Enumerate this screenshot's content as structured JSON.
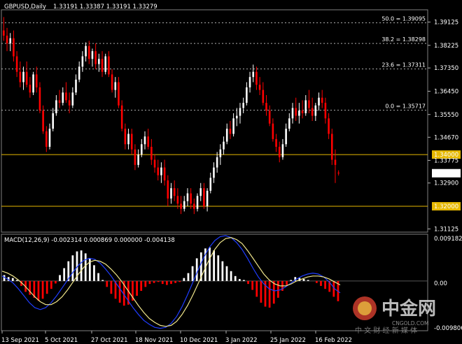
{
  "window": {
    "symbol_label": "GBPUSD,Daily",
    "ohlc_label": "1.33191 1.33387 1.33191 1.33279"
  },
  "macd": {
    "label": "MACD(12,26,9) -0.002314 0.000869 0.000000 -0.004138",
    "right_ticks": [
      "0.009182",
      "0.00",
      "-0.009806"
    ]
  },
  "fib": [
    {
      "label": "50.0 = 1.39095",
      "price": 1.39095
    },
    {
      "label": "38.2 = 1.38298",
      "price": 1.38298
    },
    {
      "label": "23.6 = 1.37311",
      "price": 1.37311
    },
    {
      "label": "0.0 = 1.35717",
      "price": 1.35717
    }
  ],
  "levels": [
    {
      "label": "1.34000",
      "price": 1.34
    },
    {
      "label": "1.32000",
      "price": 1.32
    }
  ],
  "current_price": {
    "label": "1.33279",
    "price": 1.33279
  },
  "y_ticks": [
    "1.39125",
    "1.38225",
    "1.37350",
    "1.36450",
    "1.35550",
    "1.34670",
    "1.33775",
    "1.32900",
    "1.31125"
  ],
  "x_ticks": [
    "13 Sep 2021",
    "5 Oct 2021",
    "27 Oct 2021",
    "18 Nov 2021",
    "10 Dec 2021",
    "3 Jan 2022",
    "25 Jan 2022",
    "16 Feb 2022"
  ],
  "watermark": {
    "text": "中金网",
    "url": "CNGOLD.COM",
    "sub": "中 文 财 经 新 媒 体"
  },
  "colors": {
    "up": "#ffffff",
    "down": "#ff0000",
    "level": "#e6b800",
    "macd_line": "#1f3dff",
    "signal_line": "#f0e68c",
    "grid": "#b0b0b0"
  },
  "chart_data": {
    "type": "candlestick",
    "ylim": [
      1.31,
      1.396
    ],
    "candles": [
      [
        1.388,
        1.3932,
        1.384,
        1.386
      ],
      [
        1.386,
        1.389,
        1.38,
        1.383
      ],
      [
        1.383,
        1.387,
        1.38,
        1.385
      ],
      [
        1.385,
        1.388,
        1.376,
        1.378
      ],
      [
        1.378,
        1.38,
        1.37,
        1.372
      ],
      [
        1.372,
        1.376,
        1.366,
        1.368
      ],
      [
        1.368,
        1.374,
        1.365,
        1.372
      ],
      [
        1.372,
        1.376,
        1.366,
        1.367
      ],
      [
        1.367,
        1.37,
        1.362,
        1.364
      ],
      [
        1.364,
        1.372,
        1.363,
        1.371
      ],
      [
        1.371,
        1.374,
        1.364,
        1.366
      ],
      [
        1.366,
        1.368,
        1.356,
        1.357
      ],
      [
        1.357,
        1.359,
        1.348,
        1.349
      ],
      [
        1.349,
        1.351,
        1.341,
        1.343
      ],
      [
        1.343,
        1.352,
        1.342,
        1.35
      ],
      [
        1.35,
        1.358,
        1.349,
        1.356
      ],
      [
        1.356,
        1.363,
        1.355,
        1.361
      ],
      [
        1.361,
        1.365,
        1.358,
        1.36
      ],
      [
        1.36,
        1.366,
        1.359,
        1.364
      ],
      [
        1.364,
        1.368,
        1.36,
        1.361
      ],
      [
        1.361,
        1.364,
        1.356,
        1.359
      ],
      [
        1.359,
        1.366,
        1.358,
        1.364
      ],
      [
        1.364,
        1.371,
        1.363,
        1.369
      ],
      [
        1.369,
        1.376,
        1.368,
        1.374
      ],
      [
        1.374,
        1.38,
        1.372,
        1.378
      ],
      [
        1.378,
        1.3834,
        1.376,
        1.382
      ],
      [
        1.382,
        1.384,
        1.375,
        1.377
      ],
      [
        1.377,
        1.381,
        1.374,
        1.38
      ],
      [
        1.38,
        1.383,
        1.373,
        1.375
      ],
      [
        1.375,
        1.379,
        1.372,
        1.377
      ],
      [
        1.377,
        1.38,
        1.37,
        1.372
      ],
      [
        1.372,
        1.379,
        1.371,
        1.378
      ],
      [
        1.378,
        1.38,
        1.37,
        1.371
      ],
      [
        1.371,
        1.373,
        1.364,
        1.365
      ],
      [
        1.365,
        1.37,
        1.362,
        1.368
      ],
      [
        1.368,
        1.37,
        1.358,
        1.359
      ],
      [
        1.359,
        1.361,
        1.349,
        1.35
      ],
      [
        1.35,
        1.352,
        1.342,
        1.344
      ],
      [
        1.344,
        1.35,
        1.342,
        1.348
      ],
      [
        1.348,
        1.35,
        1.34,
        1.342
      ],
      [
        1.342,
        1.344,
        1.334,
        1.336
      ],
      [
        1.336,
        1.342,
        1.335,
        1.34
      ],
      [
        1.34,
        1.346,
        1.339,
        1.344
      ],
      [
        1.344,
        1.349,
        1.342,
        1.347
      ],
      [
        1.347,
        1.35,
        1.342,
        1.343
      ],
      [
        1.343,
        1.346,
        1.336,
        1.338
      ],
      [
        1.338,
        1.34,
        1.333,
        1.335
      ],
      [
        1.335,
        1.338,
        1.33,
        1.332
      ],
      [
        1.332,
        1.337,
        1.329,
        1.335
      ],
      [
        1.335,
        1.338,
        1.328,
        1.33
      ],
      [
        1.33,
        1.332,
        1.32,
        1.323
      ],
      [
        1.323,
        1.329,
        1.321,
        1.327
      ],
      [
        1.327,
        1.33,
        1.322,
        1.324
      ],
      [
        1.324,
        1.327,
        1.319,
        1.321
      ],
      [
        1.321,
        1.324,
        1.317,
        1.319
      ],
      [
        1.319,
        1.324,
        1.318,
        1.322
      ],
      [
        1.322,
        1.327,
        1.32,
        1.325
      ],
      [
        1.325,
        1.327,
        1.319,
        1.321
      ],
      [
        1.321,
        1.323,
        1.317,
        1.319
      ],
      [
        1.319,
        1.325,
        1.318,
        1.324
      ],
      [
        1.324,
        1.329,
        1.322,
        1.327
      ],
      [
        1.327,
        1.329,
        1.319,
        1.32
      ],
      [
        1.32,
        1.327,
        1.318,
        1.326
      ],
      [
        1.326,
        1.333,
        1.325,
        1.331
      ],
      [
        1.331,
        1.337,
        1.329,
        1.335
      ],
      [
        1.335,
        1.341,
        1.333,
        1.339
      ],
      [
        1.339,
        1.344,
        1.336,
        1.342
      ],
      [
        1.342,
        1.347,
        1.34,
        1.345
      ],
      [
        1.345,
        1.352,
        1.344,
        1.35
      ],
      [
        1.35,
        1.353,
        1.346,
        1.348
      ],
      [
        1.348,
        1.356,
        1.347,
        1.354
      ],
      [
        1.354,
        1.358,
        1.351,
        1.355
      ],
      [
        1.355,
        1.36,
        1.352,
        1.358
      ],
      [
        1.358,
        1.362,
        1.356,
        1.36
      ],
      [
        1.36,
        1.368,
        1.359,
        1.366
      ],
      [
        1.366,
        1.372,
        1.364,
        1.37
      ],
      [
        1.37,
        1.3748,
        1.368,
        1.372
      ],
      [
        1.372,
        1.374,
        1.365,
        1.367
      ],
      [
        1.367,
        1.37,
        1.363,
        1.365
      ],
      [
        1.365,
        1.368,
        1.359,
        1.36
      ],
      [
        1.36,
        1.363,
        1.355,
        1.357
      ],
      [
        1.357,
        1.359,
        1.351,
        1.352
      ],
      [
        1.352,
        1.354,
        1.345,
        1.346
      ],
      [
        1.346,
        1.348,
        1.341,
        1.343
      ],
      [
        1.343,
        1.345,
        1.337,
        1.339
      ],
      [
        1.339,
        1.346,
        1.338,
        1.344
      ],
      [
        1.344,
        1.352,
        1.343,
        1.35
      ],
      [
        1.35,
        1.356,
        1.349,
        1.354
      ],
      [
        1.354,
        1.36,
        1.352,
        1.358
      ],
      [
        1.358,
        1.362,
        1.353,
        1.355
      ],
      [
        1.355,
        1.36,
        1.352,
        1.357
      ],
      [
        1.357,
        1.361,
        1.354,
        1.356
      ],
      [
        1.356,
        1.363,
        1.355,
        1.361
      ],
      [
        1.361,
        1.365,
        1.356,
        1.358
      ],
      [
        1.358,
        1.362,
        1.353,
        1.355
      ],
      [
        1.355,
        1.36,
        1.353,
        1.359
      ],
      [
        1.359,
        1.364,
        1.357,
        1.362
      ],
      [
        1.362,
        1.365,
        1.358,
        1.36
      ],
      [
        1.36,
        1.362,
        1.352,
        1.354
      ],
      [
        1.354,
        1.356,
        1.346,
        1.348
      ],
      [
        1.348,
        1.35,
        1.336,
        1.338
      ],
      [
        1.338,
        1.342,
        1.329,
        1.336
      ],
      [
        1.333,
        1.3339,
        1.3319,
        1.3328
      ]
    ],
    "macd_histogram": [
      0.0012,
      0.0008,
      0.0006,
      0.0002,
      -0.001,
      -0.0022,
      -0.0028,
      -0.0034,
      -0.004,
      -0.0036,
      -0.0026,
      -0.0016,
      -0.0005,
      0.0012,
      0.0026,
      0.004,
      0.0052,
      0.006,
      0.0062,
      0.0056,
      0.0046,
      0.0032,
      0.0016,
      0.0002,
      -0.0012,
      -0.0026,
      -0.0036,
      -0.0044,
      -0.005,
      -0.0048,
      -0.004,
      -0.003,
      -0.002,
      -0.0012,
      -0.0006,
      -0.0004,
      -0.0002,
      -0.0006,
      -0.0008,
      -0.0006,
      -0.0004,
      -0.0002,
      0.0006,
      0.0016,
      0.003,
      0.0046,
      0.0058,
      0.0066,
      0.0068,
      0.0062,
      0.0052,
      0.004,
      0.003,
      0.002,
      0.001,
      0.0004,
      0.0002,
      -0.0006,
      -0.0018,
      -0.0032,
      -0.0044,
      -0.0052,
      -0.0054,
      -0.0046,
      -0.0034,
      -0.002,
      -0.0008,
      0.0002,
      0.0008,
      0.0006,
      0.0004,
      0.0002,
      0.0,
      -0.0004,
      -0.001,
      -0.0016,
      -0.0022,
      -0.0032,
      -0.0041
    ],
    "macd_line": [
      0.001,
      0.0004,
      -0.0004,
      -0.0016,
      -0.003,
      -0.0044,
      -0.0054,
      -0.0058,
      -0.0054,
      -0.0044,
      -0.003,
      -0.0014,
      0.0002,
      0.0018,
      0.0032,
      0.0042,
      0.0046,
      0.0044,
      0.0036,
      0.0024,
      0.001,
      -0.0006,
      -0.0022,
      -0.0038,
      -0.0054,
      -0.0068,
      -0.008,
      -0.0088,
      -0.0094,
      -0.0096,
      -0.0094,
      -0.0086,
      -0.0072,
      -0.0052,
      -0.0028,
      -0.0002,
      0.0024,
      0.0048,
      0.0068,
      0.0082,
      0.009,
      0.0092,
      0.0088,
      0.0078,
      0.0064,
      0.0046,
      0.0026,
      0.0008,
      -0.0006,
      -0.0016,
      -0.002,
      -0.0018,
      -0.0012,
      -0.0004,
      0.0004,
      0.001,
      0.0014,
      0.0016,
      0.0014,
      0.0008,
      -0.0002,
      -0.0016,
      -0.0024
    ],
    "signal_line": [
      0.002,
      0.0016,
      0.001,
      0.0002,
      -0.0008,
      -0.002,
      -0.0032,
      -0.0042,
      -0.0048,
      -0.0048,
      -0.0042,
      -0.0032,
      -0.0018,
      -0.0002,
      0.0014,
      0.0028,
      0.0038,
      0.0042,
      0.004,
      0.0034,
      0.0024,
      0.0012,
      -0.0002,
      -0.0018,
      -0.0034,
      -0.005,
      -0.0064,
      -0.0076,
      -0.0084,
      -0.009,
      -0.0092,
      -0.009,
      -0.0082,
      -0.0068,
      -0.005,
      -0.0028,
      -0.0004,
      0.002,
      0.0044,
      0.0064,
      0.0078,
      0.0086,
      0.0088,
      0.0084,
      0.0076,
      0.0062,
      0.0046,
      0.003,
      0.0014,
      0.0002,
      -0.0006,
      -0.001,
      -0.001,
      -0.0006,
      0.0,
      0.0004,
      0.0008,
      0.001,
      0.001,
      0.0008,
      0.0004,
      -0.0002,
      -0.0008
    ],
    "macd_ylim": [
      -0.0098,
      0.0092
    ]
  }
}
